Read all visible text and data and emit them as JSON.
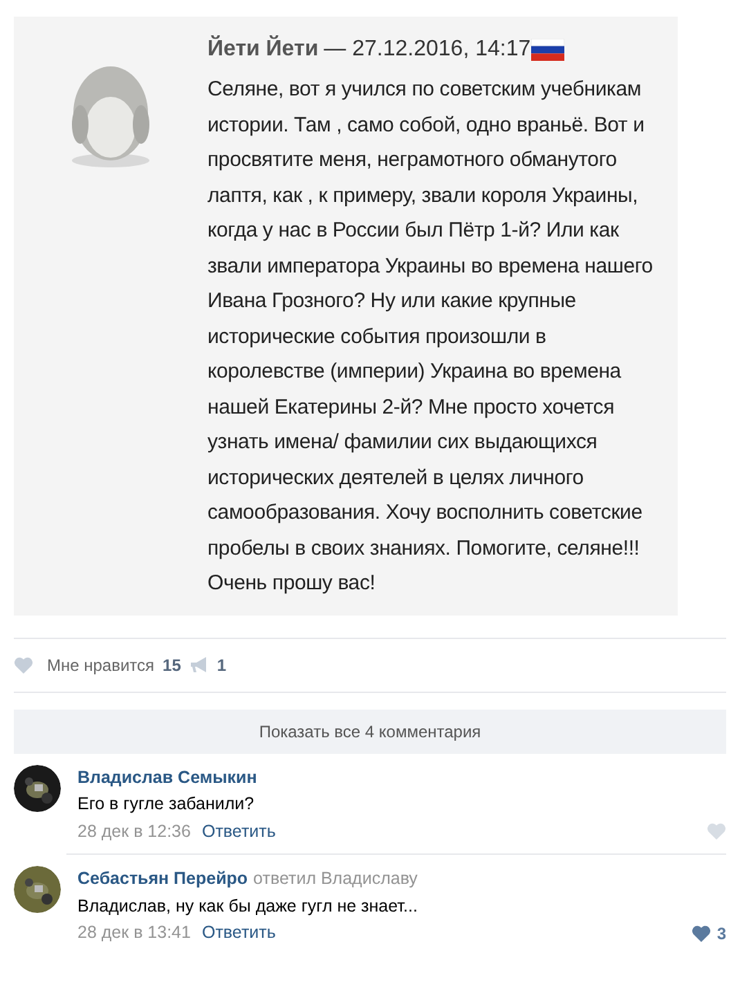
{
  "post": {
    "author": "Йети Йети",
    "date": "— 27.12.2016, 14:17",
    "text": "Селяне, вот я учился по советским учебникам истории. Там , само собой, одно враньё. Вот и просвятите меня, неграмотного обманутого лаптя, как , к примеру, звали короля Украины, когда у нас в России был Пётр 1-й? Или как звали императора Украины во времена нашего Ивана Грозного? Ну или какие крупные исторические события произошли в королевстве (империи) Украина во времена нашей Екатерины 2-й? Мне просто хочется узнать имена/ фамилии сих выдающихся исторических деятелей в целях личного самообразования. Хочу восполнить советские пробелы в своих знаниях. Помогите, селяне!!! Очень прошу вас!"
  },
  "actions": {
    "like_label": "Мне нравится",
    "like_count": "15",
    "share_count": "1"
  },
  "show_all": "Показать все 4 комментария",
  "comments": [
    {
      "author": "Владислав Семыкин",
      "text": "Его в гугле забанили?",
      "time": "28 дек в 12:36",
      "reply": "Ответить"
    },
    {
      "author": "Себастьян Перейро",
      "reply_to": "ответил Владиславу",
      "text": "Владислав, ну как бы даже гугл не знает...",
      "time": "28 дек в 13:41",
      "reply": "Ответить",
      "likes": "3"
    }
  ]
}
